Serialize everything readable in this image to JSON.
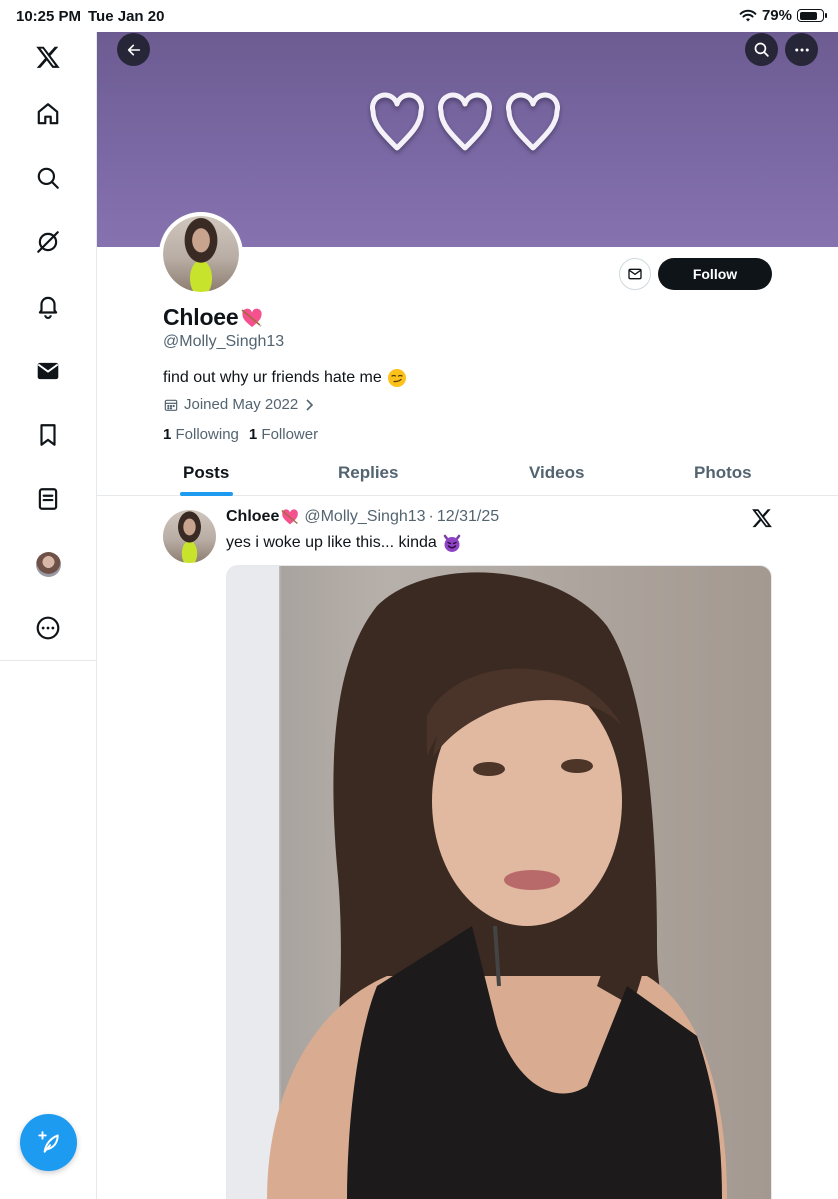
{
  "status_bar": {
    "time": "10:25 PM",
    "date": "Tue Jan 20",
    "battery_percent": "79%",
    "battery_level": 0.79,
    "wifi_icon": "wifi-icon"
  },
  "sidebar": {
    "items": [
      {
        "name": "x-logo-icon"
      },
      {
        "name": "home-icon"
      },
      {
        "name": "search-icon"
      },
      {
        "name": "grok-icon"
      },
      {
        "name": "notifications-icon"
      },
      {
        "name": "messages-icon"
      },
      {
        "name": "bookmarks-icon"
      },
      {
        "name": "lists-icon"
      },
      {
        "name": "profile-avatar-icon"
      },
      {
        "name": "more-icon"
      }
    ],
    "compose_icon": "compose-feather-icon"
  },
  "banner": {
    "back_icon": "back-arrow-icon",
    "search_icon": "search-icon",
    "more_icon": "more-icon",
    "hearts": 3
  },
  "profile": {
    "display_name": "Chloee",
    "name_emoji": "heart-with-arrow-icon",
    "handle": "@Molly_Singh13",
    "bio": "find out why ur friends hate me",
    "bio_emoji": "smirking-face-icon",
    "joined": "Joined May 2022",
    "following_count": "1",
    "following_label": "Following",
    "followers_count": "1",
    "followers_label": "Follower",
    "follow_label": "Follow",
    "message_icon": "mail-icon"
  },
  "tabs": [
    {
      "label": "Posts",
      "active": true
    },
    {
      "label": "Replies",
      "active": false
    },
    {
      "label": "Videos",
      "active": false
    },
    {
      "label": "Photos",
      "active": false
    }
  ],
  "post": {
    "author_name": "Chloee",
    "author_handle": "@Molly_Singh13",
    "separator": "·",
    "date": "12/31/25",
    "text": "yes i woke up like this... kinda",
    "text_emoji": "smiling-devil-icon",
    "source_icon": "x-logo-icon"
  },
  "colors": {
    "accent": "#1d9bf0",
    "banner": "#7a68a4",
    "text_primary": "#0f1419",
    "text_secondary": "#536471"
  }
}
